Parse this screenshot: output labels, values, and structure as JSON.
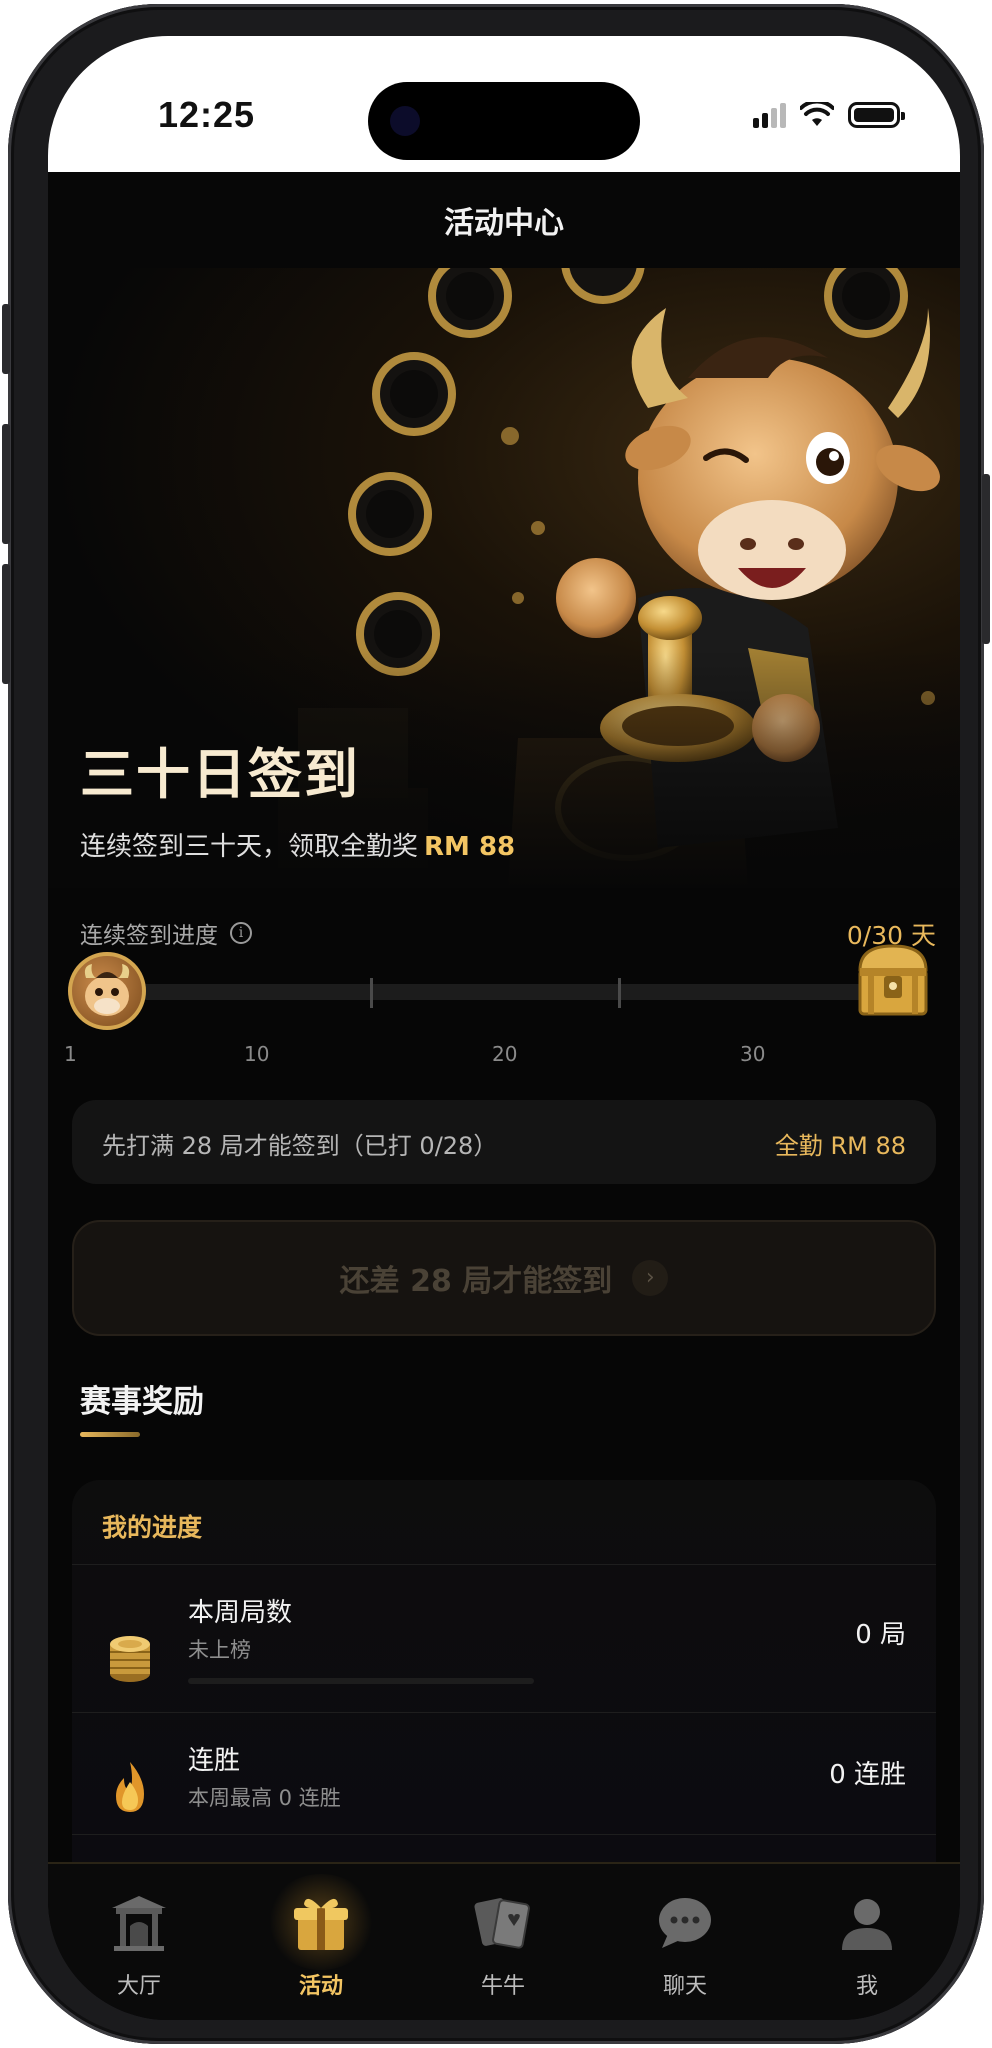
{
  "status_bar": {
    "time": "12:25"
  },
  "header": {
    "title": "活动中心"
  },
  "hero": {
    "title": "三十日签到",
    "subtitle_text": "连续签到三十天，领取全勤奖",
    "subtitle_amount": "RM 88"
  },
  "progress": {
    "label": "连续签到进度",
    "info_icon": "info-icon",
    "days_text": "0/30 天",
    "value": 0,
    "ticks": [
      "1",
      "10",
      "20",
      "30"
    ]
  },
  "notice": {
    "left": "先打满 28 局才能签到（已打 0/28）",
    "right": "全勤 RM 88"
  },
  "checkin_button": {
    "label": "还差 28 局才能签到",
    "chevron": "›"
  },
  "section": {
    "title": "赛事奖励"
  },
  "my_progress": {
    "title": "我的进度",
    "rows": [
      {
        "icon": "coin-stack-icon",
        "label": "本周局数",
        "sub": "未上榜",
        "value": "0 局"
      },
      {
        "icon": "flame-icon",
        "label": "连胜",
        "sub": "本周最高 0 连胜",
        "value": "0 连胜"
      }
    ]
  },
  "tabbar": {
    "items": [
      {
        "icon": "temple-icon",
        "label": "大厅"
      },
      {
        "icon": "gift-icon",
        "label": "活动"
      },
      {
        "icon": "cards-icon",
        "label": "牛牛"
      },
      {
        "icon": "chat-icon",
        "label": "聊天"
      },
      {
        "icon": "user-icon",
        "label": "我"
      }
    ],
    "active": "活动"
  },
  "colors": {
    "accent": "#e8b85c",
    "background": "#060606"
  }
}
